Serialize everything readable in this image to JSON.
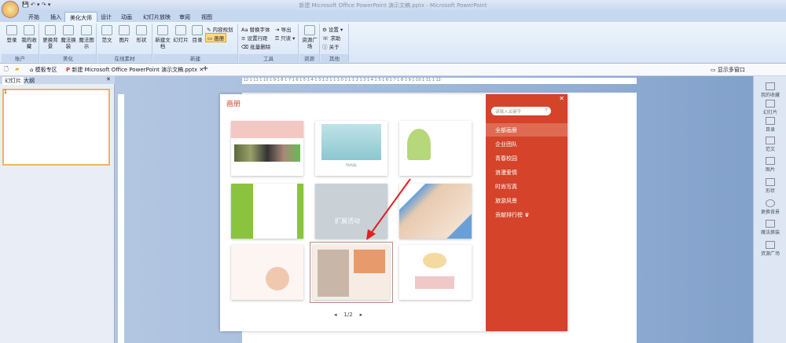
{
  "window": {
    "title": "新建 Microsoft Office PowerPoint 演示文稿.pptx - Microsoft PowerPoint"
  },
  "ribbon_tabs": [
    "开始",
    "插入",
    "美化大师",
    "设计",
    "动画",
    "幻灯片放映",
    "审阅",
    "视图"
  ],
  "ribbon": {
    "account": {
      "label": "账户",
      "login": "登录",
      "favorites": "我的收藏"
    },
    "beautify": {
      "label": "美化",
      "bg": "更换背景",
      "magic": "魔法换装",
      "magic_fig": "魔法图示"
    },
    "online": {
      "label": "在线素材",
      "text": "范文",
      "picture": "图片",
      "shape": "形状"
    },
    "create": {
      "label": "新建",
      "doc": "新建文档",
      "slide": "幻灯片",
      "toc": "目录",
      "plan": "内容规划",
      "album": "画册"
    },
    "tools": {
      "label": "工具",
      "font": "替换字体",
      "export": "导出",
      "spacing": "设置行距",
      "readonly": "只读",
      "batch": "批量删除"
    },
    "resource": {
      "label": "资源",
      "square": "资源广场"
    },
    "other": {
      "label": "其他",
      "settings": "设置",
      "help": "求助",
      "about": "关于"
    }
  },
  "doc_tabs": {
    "template": "模板专区",
    "file": "新建 Microsoft Office PowerPoint 演示文稿.pptx",
    "multi": "显示多窗口"
  },
  "left_panel": {
    "tab_slides": "幻灯片",
    "tab_outline": "大纲",
    "slide_number": "1"
  },
  "ruler": "·12·1·11·1·10·1·9·1·8·1·7·1·6·1·5·1·4·1·3·1·2·1·1·1·0·1·1·1·2·1·3·1·4·1·5·1·6·1·7·1·8·1·9·1·10·1·11·1·12·",
  "right_bar": [
    "我的收藏",
    "幻灯片",
    "目录",
    "范文",
    "图片",
    "形状",
    "更换背景",
    "魔法换装",
    "资源广场"
  ],
  "dialog": {
    "title": "画册",
    "search_placeholder": "请输入关键字",
    "categories": [
      "全部画册",
      "企业团队",
      "青春校园",
      "浪漫爱情",
      "时尚写真",
      "旅游风景",
      "贡献排行榜"
    ],
    "page": "1/2",
    "card_captions": [
      "TRAVEL",
      "扩展活动"
    ]
  },
  "colors": {
    "accent": "#d4432a"
  }
}
